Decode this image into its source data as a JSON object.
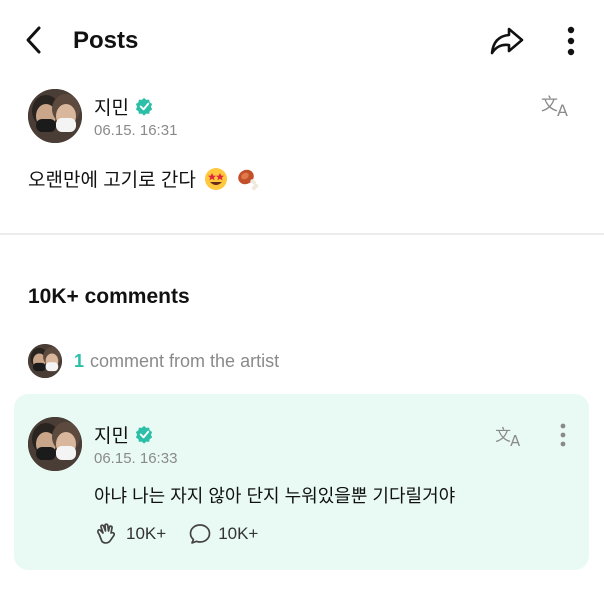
{
  "header": {
    "title": "Posts",
    "back_icon": "chevron-left-icon",
    "share_icon": "share-arrow-icon",
    "more_icon": "more-vertical-icon"
  },
  "post": {
    "author": "지민",
    "verified_icon": "verified-badge-icon",
    "timestamp": "06.15. 16:31",
    "body": "오랜만에 고기로 간다",
    "emojis": [
      "star-struck-emoji",
      "meat-on-bone-emoji"
    ],
    "translate_icon": "translate-icon"
  },
  "comments": {
    "count_label": "10K+ comments",
    "artist_count": "1",
    "artist_label": "comment from the artist",
    "items": [
      {
        "author": "지민",
        "timestamp": "06.15. 16:33",
        "body": "아냐 나는 자지 않아 단지 누워있을뿐 기다릴거야",
        "likes": "10K+",
        "replies": "10K+"
      }
    ]
  },
  "colors": {
    "accent": "#2bbfa8",
    "card_bg": "#e9faf5",
    "muted_text": "#8a8a8a"
  }
}
